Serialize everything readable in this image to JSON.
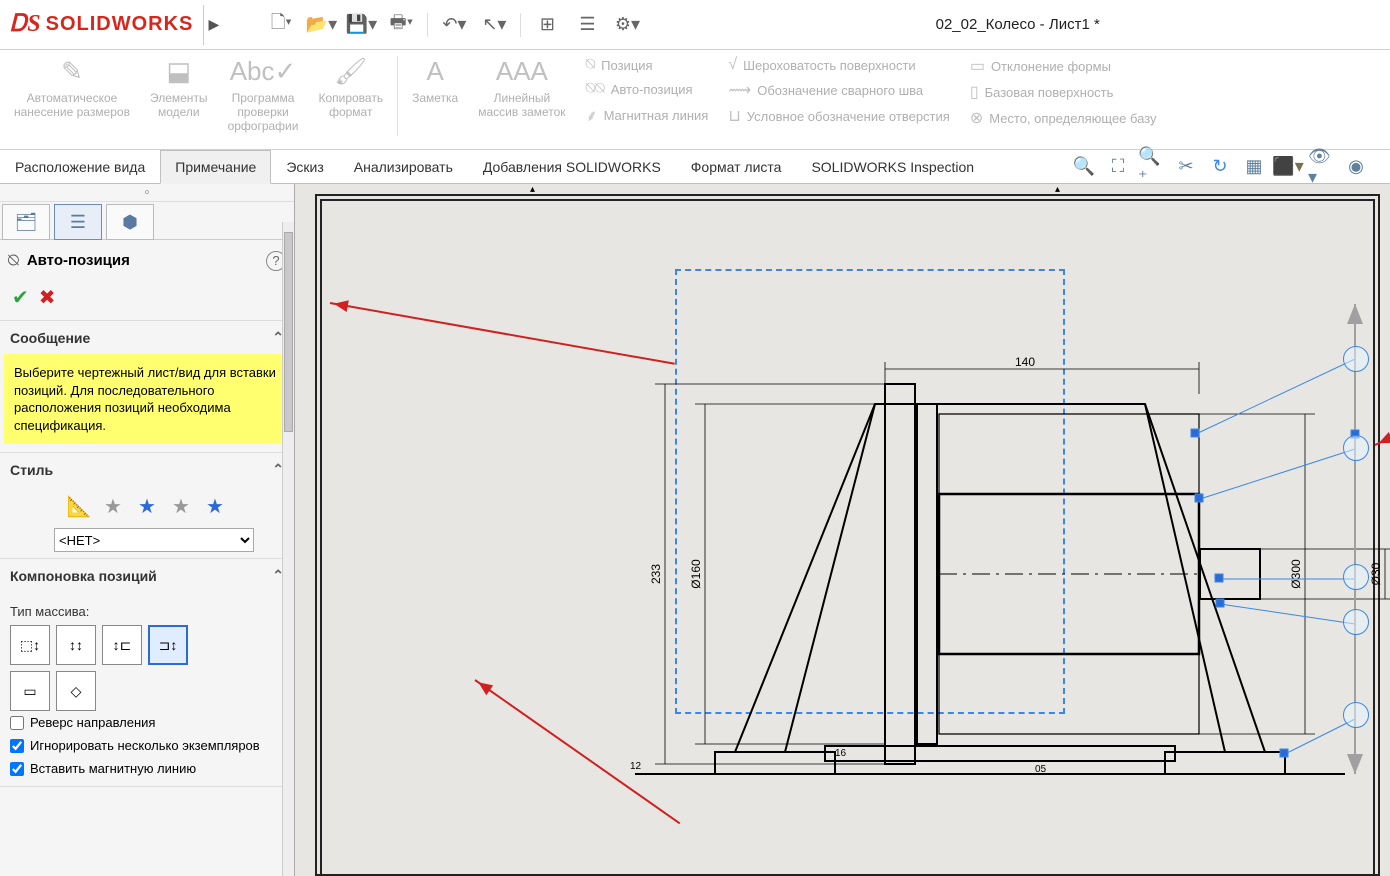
{
  "app": {
    "logo": "SOLIDWORKS",
    "doc_title": "02_02_Колесо - Лист1 *"
  },
  "ribbon": {
    "g1": "Автоматическое\nнанесение размеров",
    "g2": "Элементы\nмодели",
    "g3": "Программа\nпроверки\nорфографии",
    "g4": "Копировать\nформат",
    "g5": "Заметка",
    "g6": "Линейный\nмассив заметок",
    "c1a": "Позиция",
    "c1b": "Авто-позиция",
    "c1c": "Магнитная линия",
    "c2a": "Шероховатость поверхности",
    "c2b": "Обозначение сварного шва",
    "c2c": "Условное обозначение отверстия",
    "c3a": "Отклонение формы",
    "c3b": "Базовая поверхность",
    "c3c": "Место, определяющее базу"
  },
  "tabs": {
    "t1": "Расположение вида",
    "t2": "Примечание",
    "t3": "Эскиз",
    "t4": "Анализировать",
    "t5": "Добавления SOLIDWORKS",
    "t6": "Формат листа",
    "t7": "SOLIDWORKS Inspection"
  },
  "panel": {
    "title": "Авто-позиция",
    "msg_head": "Сообщение",
    "msg": "Выберите чертежный лист/вид для вставки позиций. Для последовательного расположения позиций необходима спецификация.",
    "style_head": "Стиль",
    "style_sel": "<НЕТ>",
    "layout_head": "Компоновка позиций",
    "array_type": "Тип массива:",
    "reverse": "Реверс направления",
    "ignore": "Игнорировать несколько экземпляров",
    "magnet": "Вставить магнитную линию"
  },
  "dims": {
    "d1": "140",
    "d2": "Ø160",
    "d3": "233",
    "d4": "Ø300",
    "d5": "Ø30",
    "d6": "12",
    "d7": "16",
    "d8": "05"
  }
}
